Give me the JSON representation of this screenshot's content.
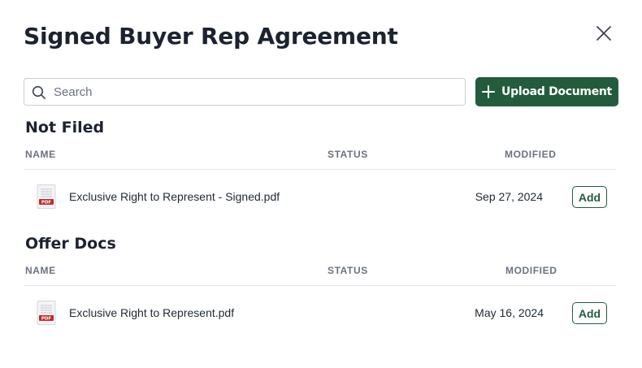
{
  "dialog": {
    "title": "Signed Buyer Rep Agreement",
    "close_icon": "close-icon"
  },
  "search": {
    "placeholder": "Search",
    "value": "",
    "icon": "search-icon"
  },
  "upload_button": {
    "label": "Upload Document",
    "icon": "plus-icon",
    "color": "#235c3d"
  },
  "columns": {
    "name": "NAME",
    "status": "STATUS",
    "modified": "MODIFIED"
  },
  "sections": [
    {
      "title": "Not Filed",
      "files": [
        {
          "name": "Exclusive Right to Represent - Signed.pdf",
          "status": "",
          "modified": "Sep 27, 2024",
          "action": "Add",
          "icon": "pdf-file-icon"
        }
      ]
    },
    {
      "title": "Offer Docs",
      "files": [
        {
          "name": "Exclusive Right to Represent.pdf",
          "status": "",
          "modified": "May 16, 2024",
          "action": "Add",
          "icon": "pdf-file-icon"
        }
      ]
    }
  ],
  "pdf_badge": "PDF",
  "colors": {
    "accent": "#235c3d",
    "pdf_red": "#c62828"
  }
}
